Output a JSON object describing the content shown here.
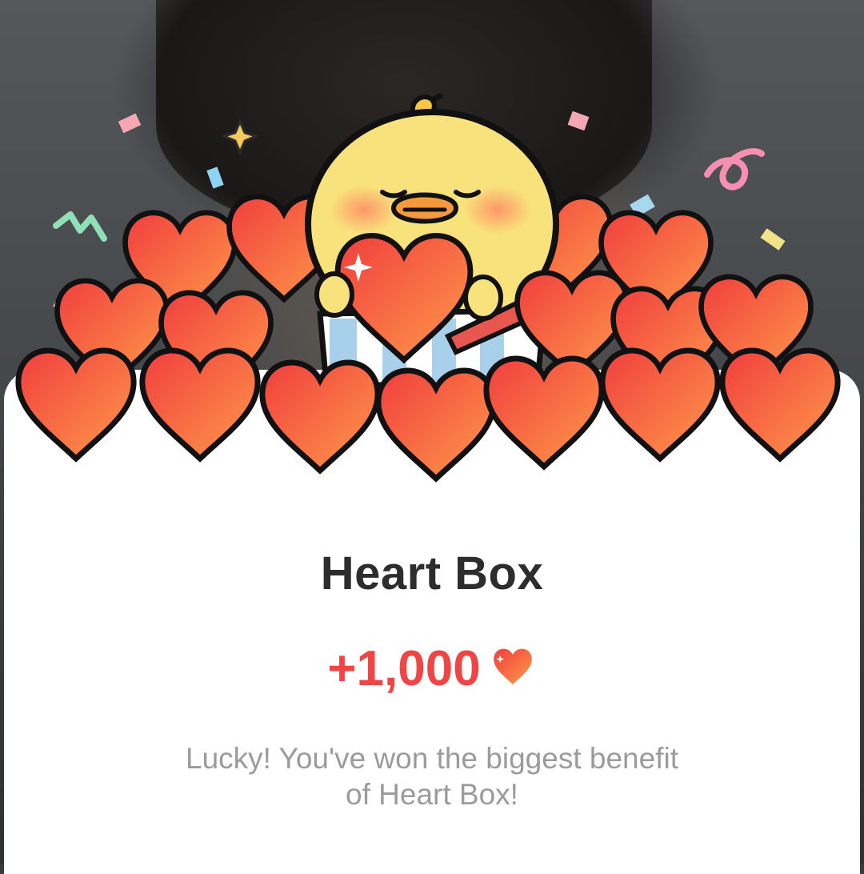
{
  "popup": {
    "title": "Heart Box",
    "reward_amount": "+1,000",
    "reward_icon": "heart-icon",
    "message_line1": "Lucky! You've won the biggest benefit",
    "message_line2": "of Heart Box!"
  },
  "colors": {
    "accent": "#ef4545",
    "heart_start": "#f03e3e",
    "heart_end": "#ff9a4a",
    "title": "#2d2d2d",
    "message": "#9b9b9b"
  }
}
